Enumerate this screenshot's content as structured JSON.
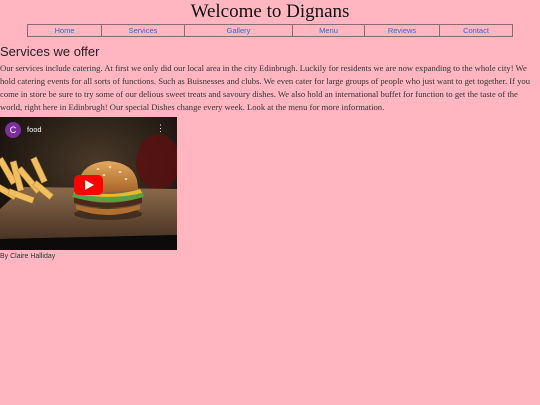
{
  "page": {
    "title": "Welcome to Dignans",
    "background": "#ffb6c1",
    "link_color": "#3a66c4"
  },
  "nav": {
    "items": [
      "Home",
      "Services",
      "Gallery",
      "Menu",
      "Reviews",
      "Contact"
    ]
  },
  "main": {
    "heading": "Services we offer",
    "body": "Our services include catering. At first we only did our local area in the city Edinbrugh. Luckily for residents we are now expanding to the whole city! We hold catering events for all sorts of functions. Such as Buisnesses and clubs. We even cater for large groups of people who just want to get together. If you come in store be sure to try some of our delious sweet treats and savoury dishes. We also hold an international buffet for function to get the taste of the world, right here in Edinbrugh! Our special Dishes change every week. Look at the menu for more information."
  },
  "video": {
    "channel_initial": "C",
    "title": "food",
    "menu_icon": "vertical-dots-icon",
    "play_icon": "youtube-play-icon",
    "play_color": "#ff0000"
  },
  "byline": "By Claire Halliday"
}
